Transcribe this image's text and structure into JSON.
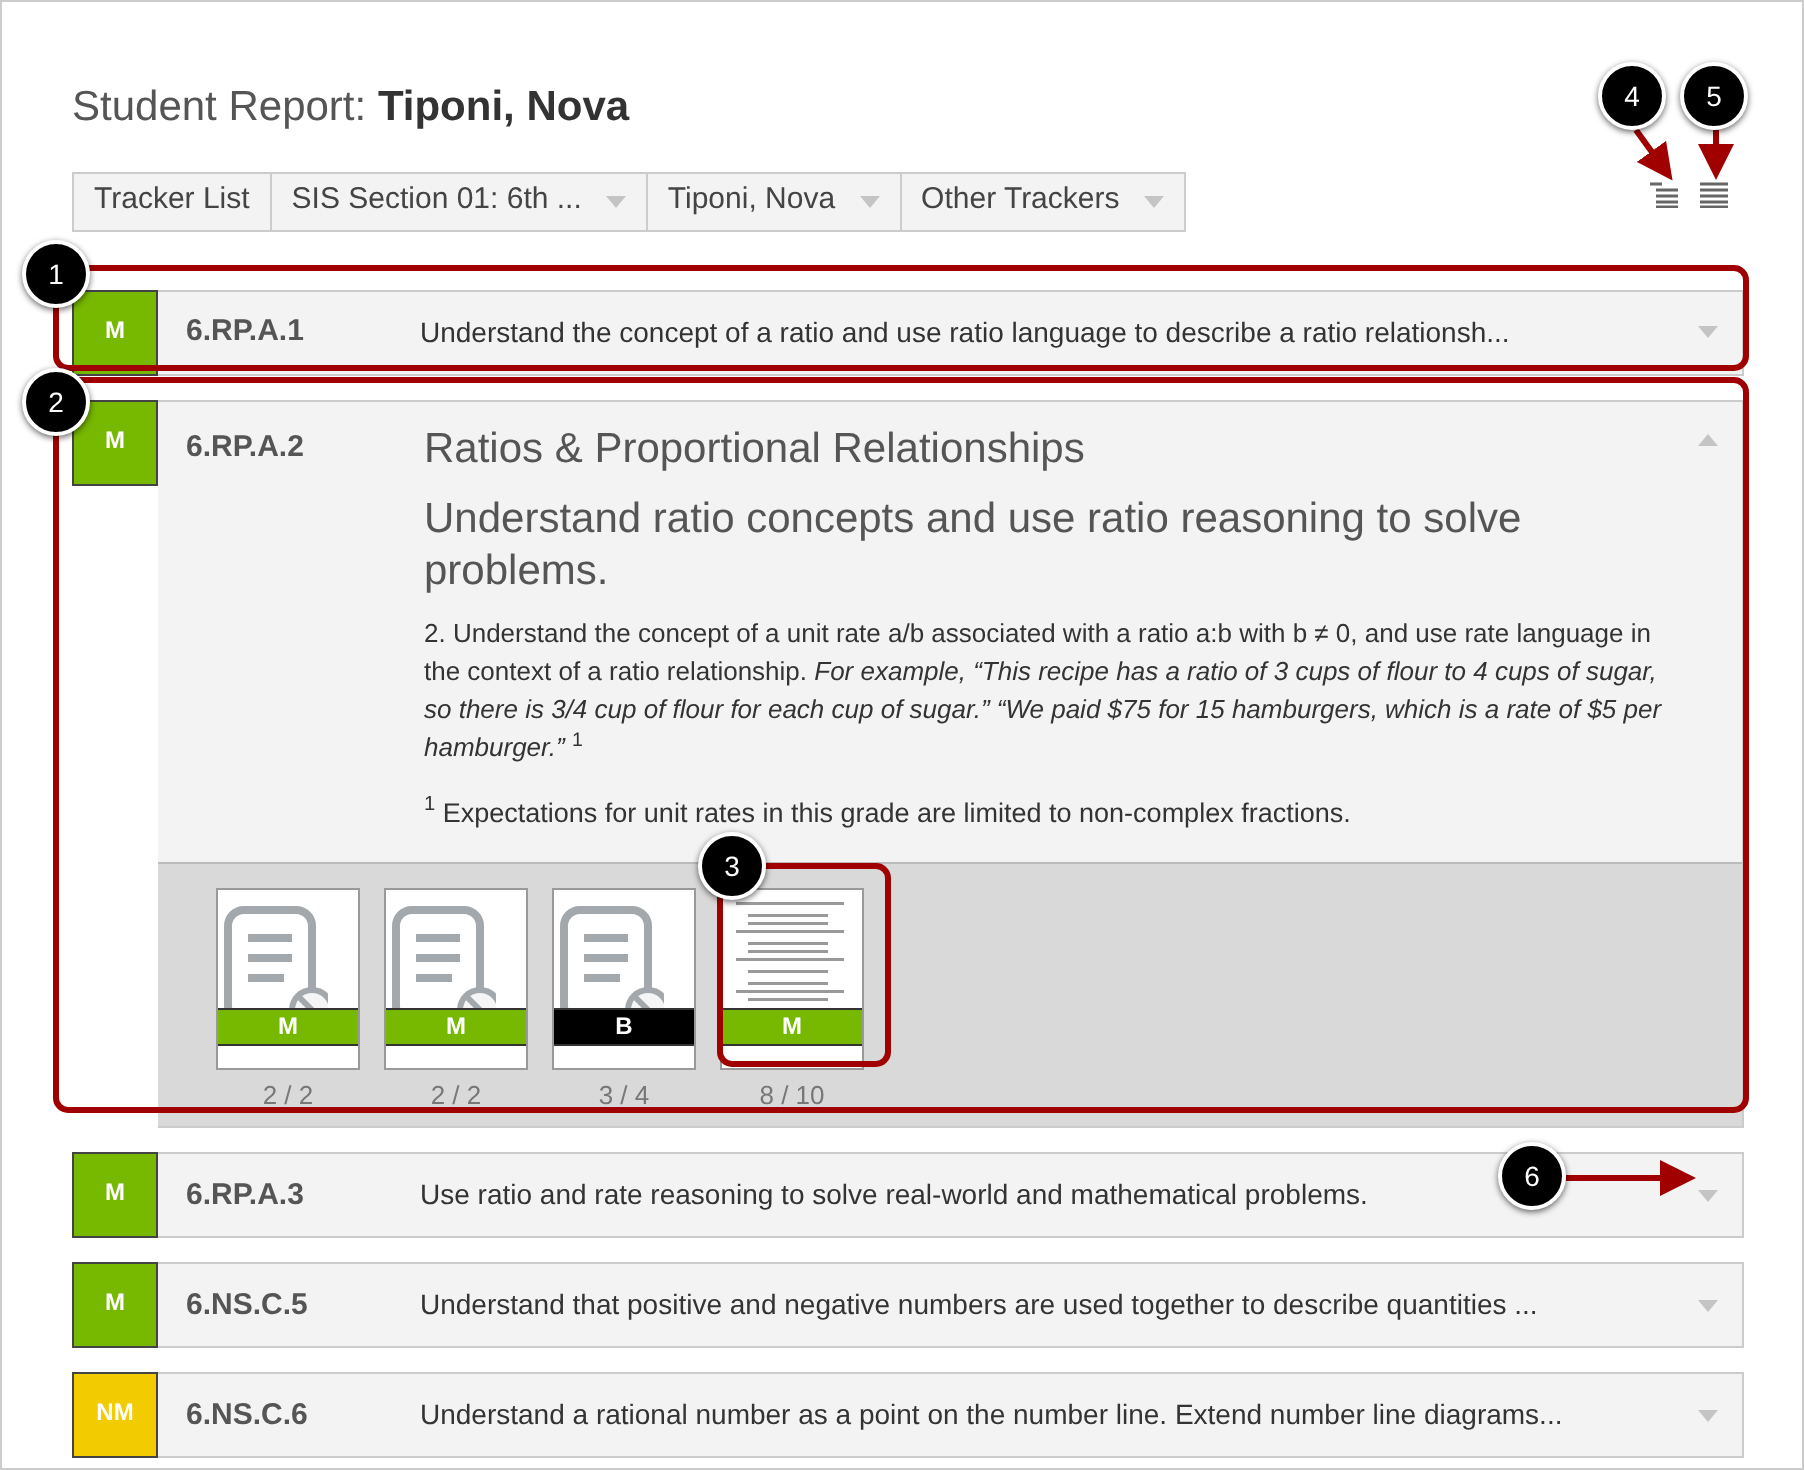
{
  "title": {
    "prefix": "Student Report:",
    "name": "Tiponi, Nova"
  },
  "breadcrumbs": [
    {
      "label": "Tracker List",
      "dropdown": false
    },
    {
      "label": "SIS Section 01: 6th ...",
      "dropdown": true
    },
    {
      "label": "Tiponi, Nova",
      "dropdown": true
    },
    {
      "label": "Other Trackers",
      "dropdown": true
    }
  ],
  "standards": [
    {
      "grade": "M",
      "color": "#77b800",
      "code": "6.RP.A.1",
      "summary": "Understand the concept of a ratio and use ratio language to describe a ratio relationsh...",
      "expanded": false
    },
    {
      "grade": "M",
      "color": "#77b800",
      "code": "6.RP.A.2",
      "expanded": true,
      "domain": "Ratios & Proportional Relationships",
      "cluster": "Understand ratio concepts and use ratio reasoning to solve problems.",
      "description": "2. Understand the concept of a unit rate a/b associated with a ratio a:b with b ≠ 0, and use rate language in the context of a ratio relationship. *For example, “This recipe has a ratio of 3 cups of flour to 4 cups of sugar, so there is 3/4 cup of flour for each cup of sugar.” “We paid $75 for 15 hamburgers, which is a rate of $5 per hamburger.”* $^{1}$",
      "footnote": "$^{1}$ Expectations for unit rates in this grade are limited to non-complex fractions.",
      "evidence": [
        {
          "kind": "placeholder",
          "grade": "M",
          "color": "#77b800",
          "score": "2 / 2"
        },
        {
          "kind": "placeholder",
          "grade": "M",
          "color": "#77b800",
          "score": "2 / 2"
        },
        {
          "kind": "placeholder",
          "grade": "B",
          "color": "#000000",
          "score": "3 / 4"
        },
        {
          "kind": "preview",
          "grade": "M",
          "color": "#77b800",
          "score": "8 / 10"
        }
      ]
    },
    {
      "grade": "M",
      "color": "#77b800",
      "code": "6.RP.A.3",
      "summary": "Use ratio and rate reasoning to solve real-world and mathematical problems.",
      "expanded": false
    },
    {
      "grade": "M",
      "color": "#77b800",
      "code": "6.NS.C.5",
      "summary": "Understand that positive and negative numbers are used together to describe quantities ...",
      "expanded": false
    },
    {
      "grade": "NM",
      "color": "#f2cc00",
      "code": "6.NS.C.6",
      "summary": "Understand a rational number as a point on the number line. Extend number line diagrams...",
      "expanded": false
    }
  ],
  "callouts": [
    {
      "number": "1"
    },
    {
      "number": "2"
    },
    {
      "number": "3"
    },
    {
      "number": "4"
    },
    {
      "number": "5"
    },
    {
      "number": "6"
    }
  ]
}
